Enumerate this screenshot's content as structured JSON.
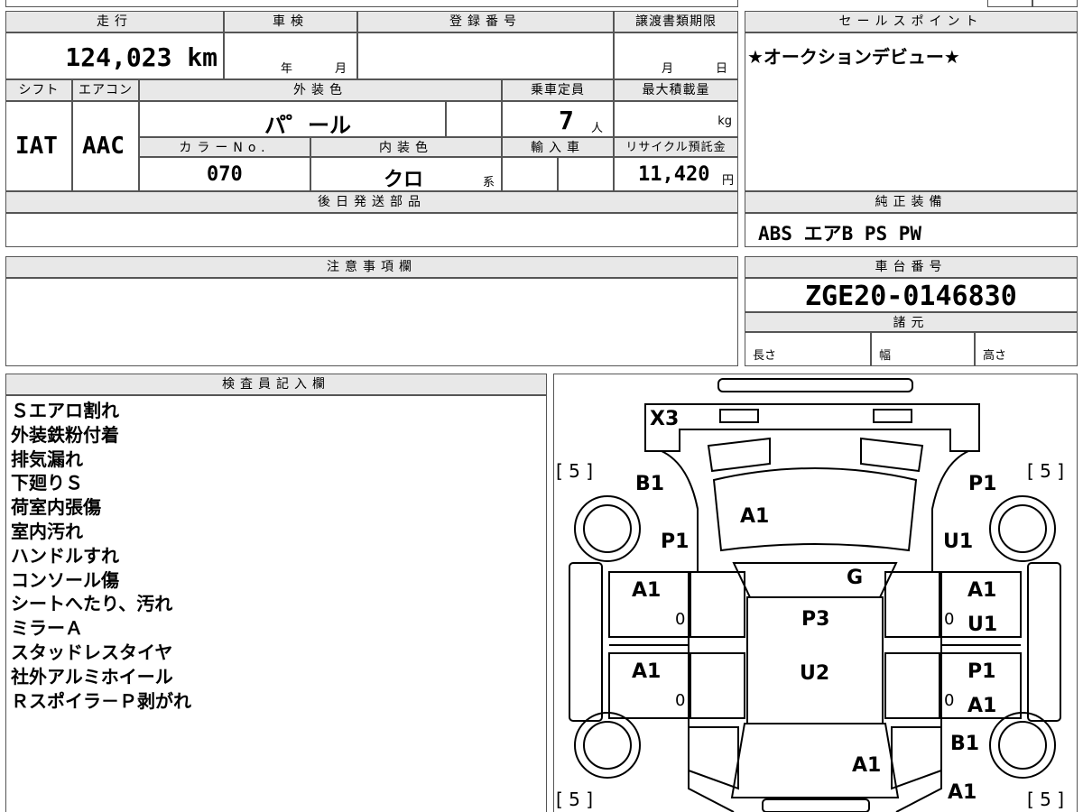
{
  "top_row": {
    "mileage_header": "走行",
    "mileage_value": "124,023 km",
    "inspection_header": "車検",
    "inspection_year_label": "年",
    "inspection_month_label": "月",
    "registration_header": "登録番号",
    "transfer_header": "譲渡書類期限",
    "transfer_month_label": "月",
    "transfer_day_label": "日"
  },
  "sales_point": {
    "header": "セールスポイント",
    "text": "★オークションデビュー★"
  },
  "row2": {
    "shift_header": "シフト",
    "shift_value": "IAT",
    "ac_header": "エアコン",
    "ac_value": "AAC",
    "exterior_color_header": "外装色",
    "exterior_color_value": "パ゜ール",
    "capacity_header": "乗車定員",
    "capacity_value": "7",
    "capacity_unit": "人",
    "max_load_header": "最大積載量",
    "max_load_unit": "kg",
    "color_no_header": "カラーNo.",
    "color_no_value": "070",
    "interior_color_header": "内装色",
    "interior_color_value": "クロ",
    "interior_color_suffix": "系",
    "import_header": "輸入車",
    "recycle_header": "リサイクル預託金",
    "recycle_value": "11,420",
    "recycle_unit": "円"
  },
  "later_parts": {
    "header": "後日発送部品"
  },
  "genuine_equipment": {
    "header": "純正装備",
    "value": "ABS エアB PS PW"
  },
  "caution": {
    "header": "注意事項欄"
  },
  "chassis": {
    "header": "車台番号",
    "value": "ZGE20-0146830",
    "specs_header": "諸元",
    "length_label": "長さ",
    "width_label": "幅",
    "height_label": "高さ"
  },
  "inspector": {
    "header": "検査員記入欄",
    "lines": [
      "Ｓエアロ割れ",
      "外装鉄粉付着",
      "排気漏れ",
      "下廻りＳ",
      "荷室内張傷",
      "室内汚れ",
      "ハンドルすれ",
      "コンソール傷",
      "シートへたり、汚れ",
      "ミラーＡ",
      "スタッドレスタイヤ",
      "社外アルミホイール",
      "Ｒスポイラ－Ｐ剥がれ"
    ]
  },
  "diagram": {
    "tire_tl": "[ 5 ]",
    "tire_tr": "[ 5 ]",
    "tire_bl": "[ 5 ]",
    "tire_br": "[ 5 ]",
    "rear": "X3",
    "rear_left_corner": "B1",
    "rear_right_corner": "P1",
    "rear_glass": "A1",
    "left_quarter": "P1",
    "right_quarter": "U1",
    "roof_right": "G",
    "left_rear_door": "A1",
    "left_rear_door_zero": "0",
    "right_rear_door": "A1",
    "right_rear_door_zero": "0",
    "right_rear_door_2": "U1",
    "roof": "P3",
    "left_front_door": "A1",
    "left_front_door_zero": "0",
    "right_front_door": "P1",
    "right_front_door_zero": "0",
    "right_front_door_2": "A1",
    "hood": "U2",
    "right_front_fender": "B1",
    "front": "A1",
    "front_right_corner": "A1"
  }
}
